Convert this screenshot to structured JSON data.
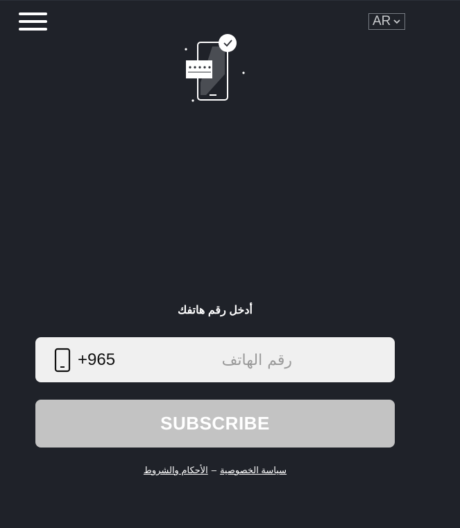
{
  "header": {
    "menu_icon": "hamburger-menu-icon",
    "language": {
      "selected": "AR",
      "icon": "chevron-down-icon"
    }
  },
  "hero": {
    "icon": "phone-verification-illustration"
  },
  "form": {
    "prompt": "أدخل رقم هاتفك",
    "phone_icon": "mobile-phone-icon",
    "country_code": "+965",
    "phone_value": "",
    "phone_placeholder": "رقم الهاتف",
    "subscribe_label": "SUBSCRIBE"
  },
  "footer": {
    "terms_label": "الأحكام والشروط",
    "separator": "–",
    "privacy_label": "سياسة الخصوصية"
  },
  "colors": {
    "background": "#1f2229",
    "input_background": "#f0f0f0",
    "button_disabled": "#c3c3c3",
    "text": "#ffffff"
  }
}
